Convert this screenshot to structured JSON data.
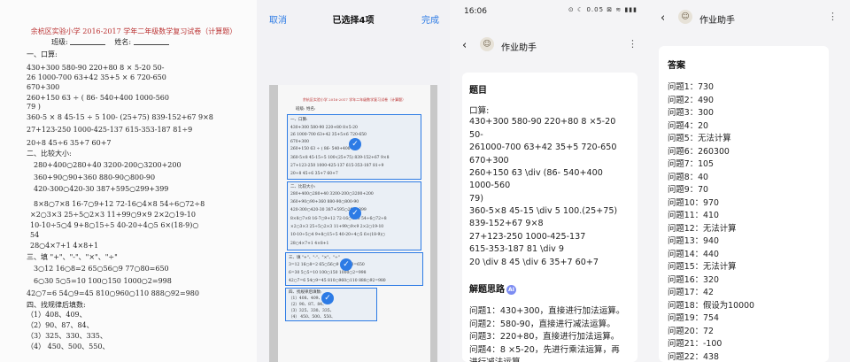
{
  "worksheet": {
    "title": "余杭区实验小学 2016-2017 学年二年级数学复习试卷（计算题）",
    "class_label": "班级:",
    "name_label": "姓名:",
    "section1": "一、口算:",
    "r1": "430+300        580-90        220+80        8  × 5-20        50-",
    "r2": "26 1000-700        63+42        35+5  ×  6        720-650",
    "r3": "670+300",
    "r4": "260+150        63  ÷  (  86-        540+400        1000-560",
    "r5": "79  )",
    "r6": "360-5 × 8        45-15 ÷ 5        100-  (25+75)        839-152+67        9×8",
    "r7": "27+123-250        1000-425-137        615-353-187        81÷9",
    "r8": "20÷8        45÷6        35+7        60+7",
    "section2": "二、比较大小:",
    "c1": "280+400○280+40                    3200-200○3200+200",
    "c2": "360+90○90+360                       880-90○800-90",
    "c3": "420-300○420-30                       387+595○299+399",
    "c4": "8×8○7×8     16-7○9+12     72-16○4×8     54÷6○72÷8",
    "c5": "×2○3×3     25÷5○2×3     11+99○9×9     2×2○19-10",
    "c6": "10-10÷5○4     9+8○15÷5     40-20÷4○5     6×(18-9)○",
    "c7": "54",
    "c8": "28○4×7+1               4×8+1",
    "section3": "三、填 \"+\"、\"-\"、\"×\"、\"÷\"",
    "f1": "3○12        16○8=2        65○56○9        77○80=650",
    "f2": "6○30        5○5=10        100○150        1000○2=998",
    "f3": "42○7=6      54○9=45      810○960○110      888○92=980",
    "section4": "四、找规律后填数:",
    "g1": "（1）408、409、",
    "g2": "（2）90、87、84、",
    "g3": "（3）325、330、335、",
    "g4": "（4）                    450、500、550、"
  },
  "selection": {
    "cancel": "取消",
    "title": "已选择4项",
    "done": "完成",
    "doc_title": "余杭区实验小学 2016-2017 学年二年级数学复习试卷（计算题）",
    "class_name": "班级:              姓名:",
    "box1": [
      "一、口算:",
      "430+300      580-90      220+80      8×5-20",
      "26 1000-700      63+42      35+5×6      720-650",
      "670+300",
      "260+150      63 ÷ ( 86-      540+400",
      "360-5×8      45-15÷5      100-(25+75)      839-152+67      9×8",
      "27+123-250      1000-425-137      615-353-187      81÷9",
      "20÷8      45÷6      35+7      60+7"
    ],
    "box2": [
      "二、比较大小:",
      "280+400○280+40              3200-200○3200+200",
      "360+90○90+360               880-90○800-90",
      "420-300○420-30              387+595○299+399",
      "8×8○7×8   16-7○9+12   72-16○4×8   54÷6○72÷8",
      "×2○3×3   25÷5○2×3   11+99○9×9   2×2○19-10",
      "10-10÷5○4   9+8○15÷5   40-20÷4○5   6×(18-9)○",
      "28○4×7+1          4×8+1"
    ],
    "box3": [
      "三、填 \"+\"、\"-\"、\"×\"、\"÷\"",
      "3=12      16○8=2      65○56○9      77○80=650",
      "6=30      5○5=10      100○150      1000○2=998",
      "42○7=6    54○9=45    810○960○110    888○92=980"
    ],
    "box4": [
      "四、找规律后填数:",
      "（1）408、409、",
      "（2）90、87、84、",
      "（3）325、330、335、",
      "（4）              450、500、550、"
    ]
  },
  "question": {
    "time": "16:06",
    "status_icons": "⊙ ☾ 0.05 ⊠ ≋ ▮▮▮",
    "app_title": "作业助手",
    "heading": "题目",
    "section": "口算:",
    "lines": [
      "430+300 580-90 220+80 8 ×5-20",
      "50-",
      "261000-700 63+42 35+5 720-650",
      "670+300",
      "260+150 63 \\div (86- 540+400",
      "1000-560",
      "79)",
      "360-5×8  45-15 \\div 5  100.(25+75)",
      "839-152+67  9×8",
      "27+123-250  1000-425-137",
      "615-353-187  81 \\div 9",
      "20 \\div 8  45 \\div 6  35+7  60+7"
    ],
    "thinking_heading": "解题思路",
    "ai_label": "AI",
    "steps": [
      "问题1：430+300，直接进行加法运算。",
      "问题2：580-90，直接进行减法运算。",
      "问题3：220+80，直接进行加法运算。",
      "问题4：8 ×5-20，先进行乘法运算，再",
      "进行减法运算"
    ]
  },
  "answers": {
    "app_title": "作业助手",
    "heading": "答案",
    "items": [
      "问题1：730",
      "问题2：490",
      "问题3：300",
      "问题4：20",
      "问题5：无法计算",
      "问题6：260300",
      "问题7：105",
      "问题8：40",
      "问题9：70",
      "问题10：970",
      "问题11：410",
      "问题12：无法计算",
      "问题13：940",
      "问题14：440",
      "问题15：无法计算",
      "问题16：320",
      "问题17：42",
      "问题18：假设为10000",
      "问题19：754",
      "问题20：72",
      "问题21：-100",
      "问题22：438"
    ]
  },
  "icons": {
    "back": "chevron-left-icon",
    "more": "more-vertical-icon",
    "check": "check-circle-icon",
    "avatar": "app-avatar-icon"
  },
  "colors": {
    "accent": "#2d7be5",
    "worksheet_title": "#b33333"
  }
}
